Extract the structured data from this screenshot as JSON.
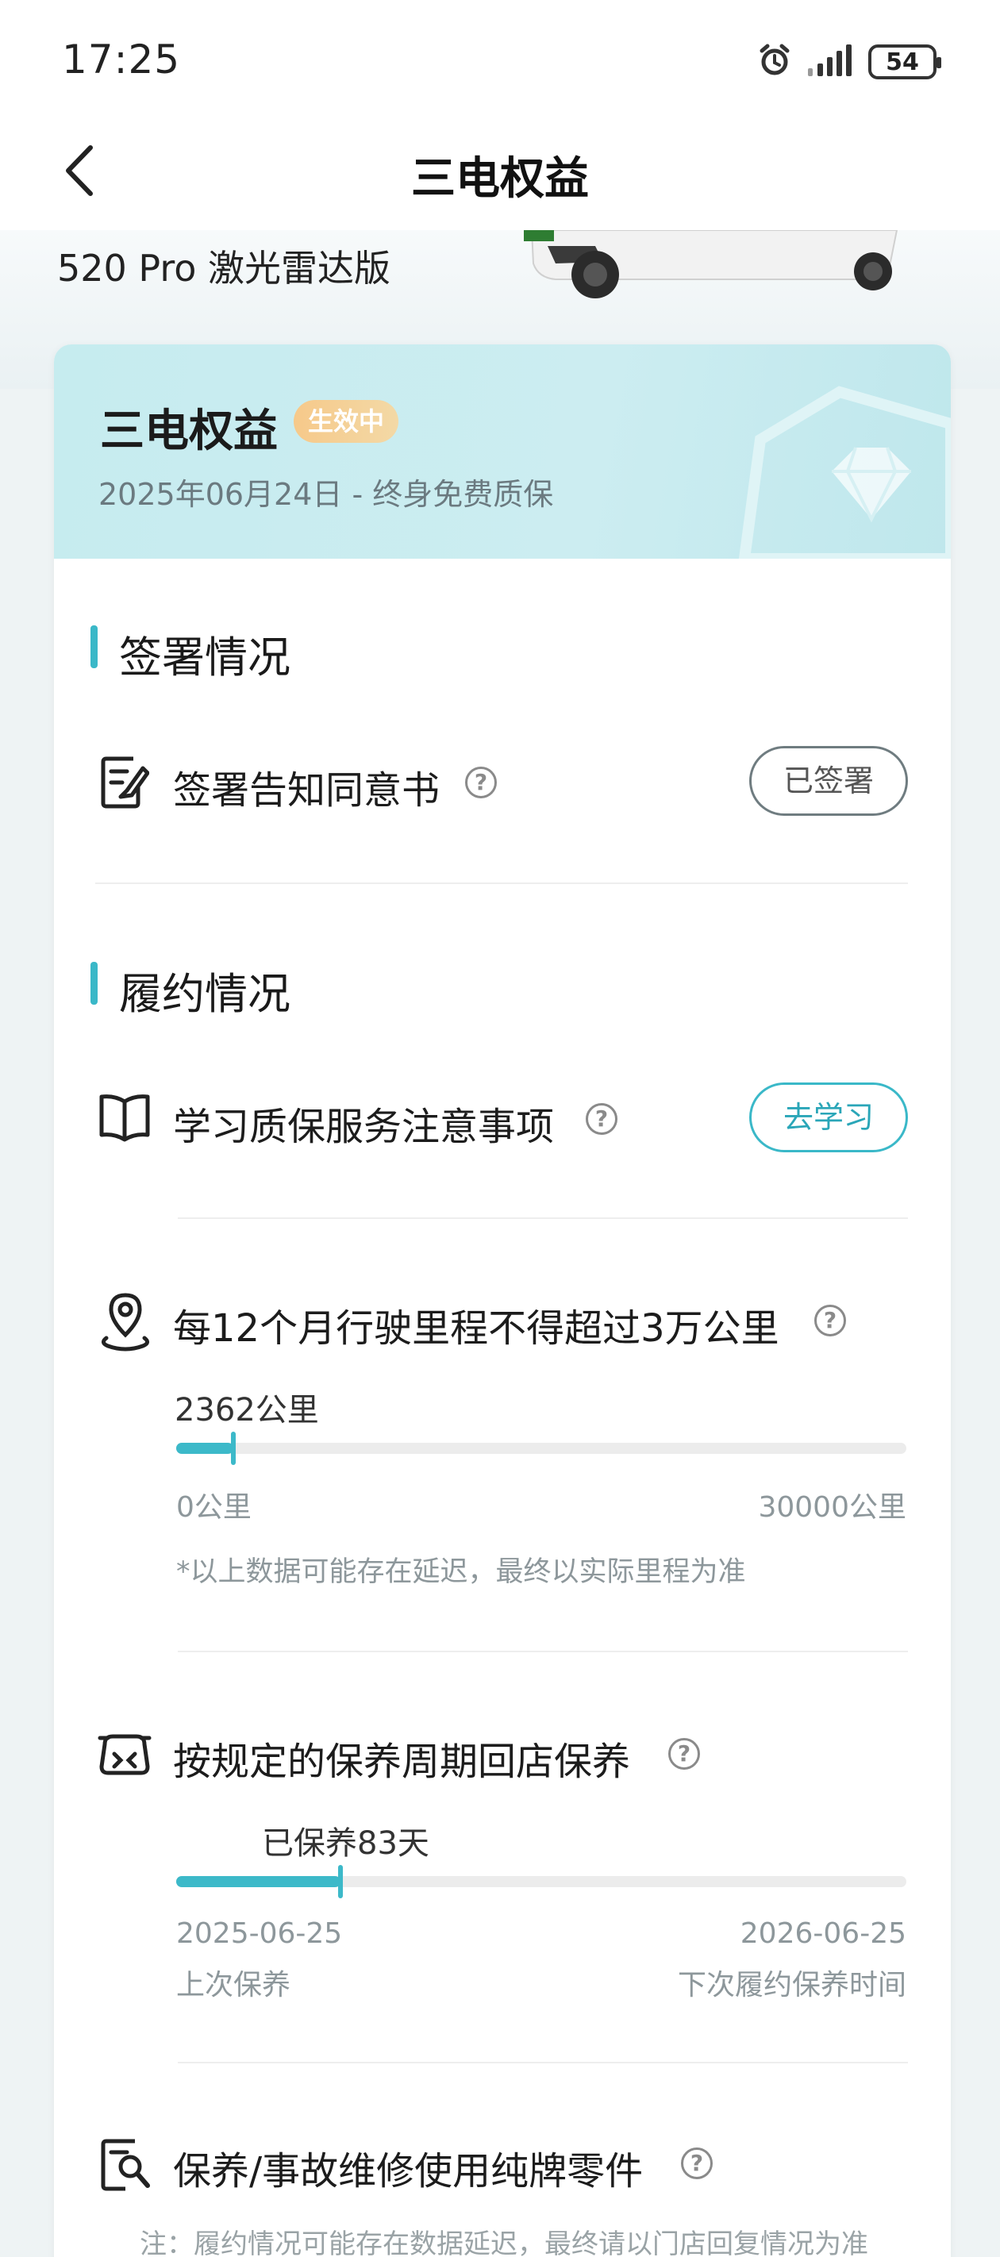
{
  "status_bar": {
    "time": "17:25",
    "battery": "54",
    "icons": [
      "alarm-icon",
      "signal-icon",
      "battery-icon"
    ]
  },
  "nav": {
    "title": "三电权益",
    "back_icon": "chevron-left-icon"
  },
  "hero": {
    "model_name": "520 Pro 激光雷达版"
  },
  "card": {
    "title": "三电权益",
    "badge": "生效中",
    "subtitle": "2025年06月24日 - 终身免费质保",
    "sections": [
      {
        "title": "签署情况"
      },
      {
        "title": "履约情况"
      }
    ],
    "signing": {
      "label": "签署告知同意书",
      "button": "已签署"
    },
    "study": {
      "label": "学习质保服务注意事项",
      "button": "去学习"
    },
    "mileage": {
      "label": "每12个月行驶里程不得超过3万公里",
      "current": "2362公里",
      "current_value": 2362,
      "max_value": 30000,
      "min_label": "0公里",
      "max_label": "30000公里",
      "note": "*以上数据可能存在延迟，最终以实际里程为准"
    },
    "maintenance": {
      "label": "按规定的保养周期回店保养",
      "current": "已保养83天",
      "progress_fraction": 0.225,
      "start_date": "2025-06-25",
      "start_label": "上次保养",
      "end_date": "2026-06-25",
      "end_label": "下次履约保养时间"
    },
    "parts": {
      "label": "保养/事故维修使用纯牌零件"
    },
    "bottom_note": "注：履约情况可能存在数据延迟，最终请以门店回复情况为准"
  },
  "colors": {
    "accent": "#3ab8c8",
    "badge": "#f3c98a",
    "header_bg": "#c6ecef"
  }
}
